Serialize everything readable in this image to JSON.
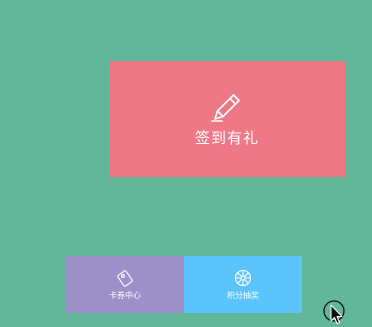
{
  "colors": {
    "background": "#62b79b",
    "checkin_tile": "#ef7886",
    "coupon_tile": "#9d90c8",
    "lottery_tile": "#5ac4fb"
  },
  "checkin": {
    "label": "签到有礼",
    "icon": "pencil-icon"
  },
  "coupon_center": {
    "label": "卡券中心",
    "icon": "coupon-card-icon"
  },
  "points_lottery": {
    "label": "积分抽奖",
    "icon": "prize-wheel-icon"
  }
}
